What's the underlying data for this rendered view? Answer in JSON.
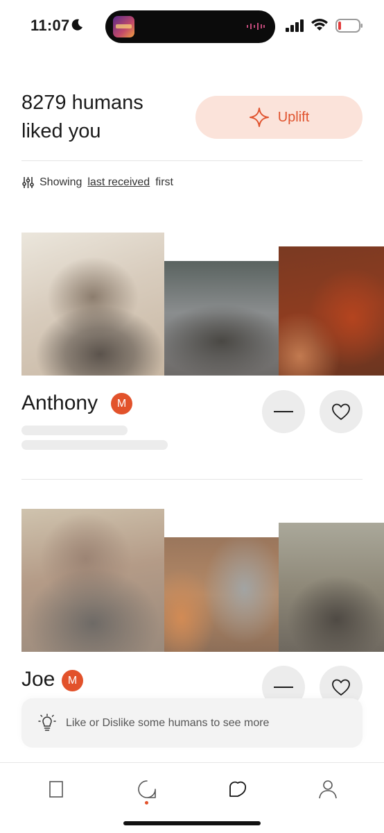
{
  "status_bar": {
    "time": "11:07"
  },
  "header": {
    "title": "8279 humans liked you",
    "uplift_label": "Uplift"
  },
  "sort": {
    "prefix": "Showing",
    "link": "last received",
    "suffix": "first"
  },
  "profiles": [
    {
      "name": "Anthony",
      "badge": "M"
    },
    {
      "name": "Joe",
      "badge": "M"
    }
  ],
  "toast": {
    "text": "Like or Dislike some humans to see more"
  },
  "tabs": [
    {
      "icon": "cards-icon"
    },
    {
      "icon": "chat-icon"
    },
    {
      "icon": "likes-icon"
    },
    {
      "icon": "profile-icon"
    }
  ],
  "colors": {
    "accent": "#e2522b",
    "uplift_bg": "#fbe3da",
    "button_bg": "#ececec"
  }
}
